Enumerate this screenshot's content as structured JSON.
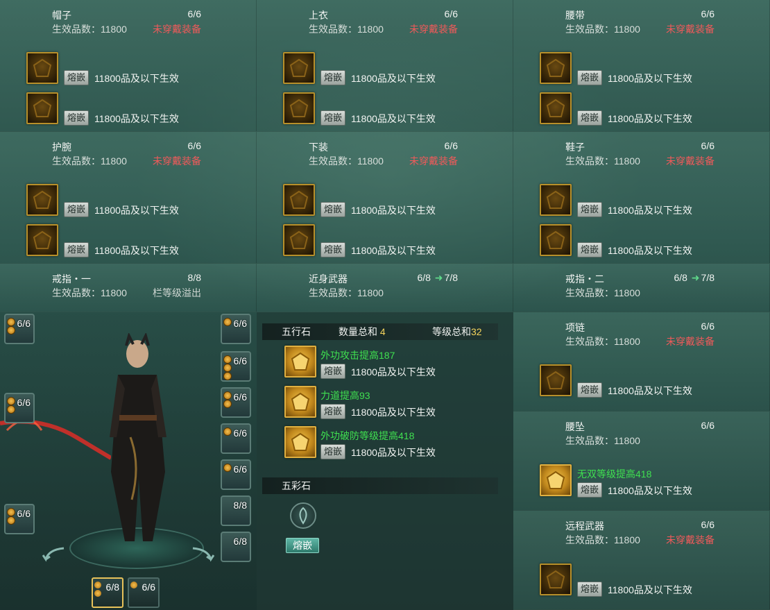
{
  "labels": {
    "effective_prefix": "生效品数：",
    "inlay": "熔嵌",
    "effect_suffix": "品及以下生效"
  },
  "panels": [
    {
      "name": "帽子",
      "count": "6/6",
      "grade": "11800",
      "status": "未穿戴装备",
      "slots": [
        {
          "grade": "11800"
        },
        {
          "grade": "11800"
        }
      ]
    },
    {
      "name": "上衣",
      "count": "6/6",
      "grade": "11800",
      "status": "未穿戴装备",
      "slots": [
        {
          "grade": "11800"
        },
        {
          "grade": "11800"
        }
      ]
    },
    {
      "name": "腰带",
      "count": "6/6",
      "grade": "11800",
      "status": "未穿戴装备",
      "slots": [
        {
          "grade": "11800"
        },
        {
          "grade": "11800"
        }
      ]
    },
    {
      "name": "护腕",
      "count": "6/6",
      "grade": "11800",
      "status": "未穿戴装备",
      "slots": [
        {
          "grade": "11800"
        },
        {
          "grade": "11800"
        }
      ]
    },
    {
      "name": "下装",
      "count": "6/6",
      "grade": "11800",
      "status": "未穿戴装备",
      "slots": [
        {
          "grade": "11800"
        },
        {
          "grade": "11800"
        }
      ]
    },
    {
      "name": "鞋子",
      "count": "6/6",
      "grade": "11800",
      "status": "未穿戴装备",
      "slots": [
        {
          "grade": "11800"
        },
        {
          "grade": "11800"
        }
      ]
    },
    {
      "name": "戒指・一",
      "count": "8/8",
      "grade": "11800",
      "status": "栏等级溢出"
    },
    {
      "name": "近身武器",
      "count": "6/8",
      "count_next": "7/8",
      "grade": "11800"
    },
    {
      "name": "戒指・二",
      "count": "6/8",
      "count_next": "7/8",
      "grade": "11800"
    },
    {
      "name": "项链",
      "count": "6/6",
      "grade": "11800",
      "status": "未穿戴装备",
      "slots": [
        {
          "grade": "11800"
        }
      ]
    },
    {
      "name": "腰坠",
      "count": "6/6",
      "grade": "11800",
      "slots": [
        {
          "grade": "11800",
          "bonus": "无双等级提高418"
        }
      ]
    },
    {
      "name": "远程武器",
      "count": "6/6",
      "grade": "11800",
      "status": "未穿戴装备",
      "slots": [
        {
          "grade": "11800"
        }
      ]
    }
  ],
  "stones": {
    "title": "五行石",
    "count_label": "数量总和",
    "count": "4",
    "level_label": "等级总和",
    "level": "32",
    "items": [
      {
        "bonus": "外功攻击提高187",
        "grade": "11800"
      },
      {
        "bonus": "力道提高93",
        "grade": "11800"
      },
      {
        "bonus": "外功破防等级提高418",
        "grade": "11800"
      }
    ],
    "colorful_title": "五彩石",
    "colorful_button": "熔嵌"
  },
  "char_slots": {
    "left": [
      "6/6",
      "6/6",
      "6/6"
    ],
    "right": [
      "6/6",
      "6/6",
      "6/6",
      "6/6",
      "6/6",
      "8/8",
      "6/8"
    ],
    "bottom": [
      "6/8",
      "6/6"
    ]
  },
  "colors": {
    "bonus": "#3fe050",
    "status_warn": "#f05a5a",
    "highlight": "#f4d45c",
    "gem_border": "#b8902a"
  }
}
